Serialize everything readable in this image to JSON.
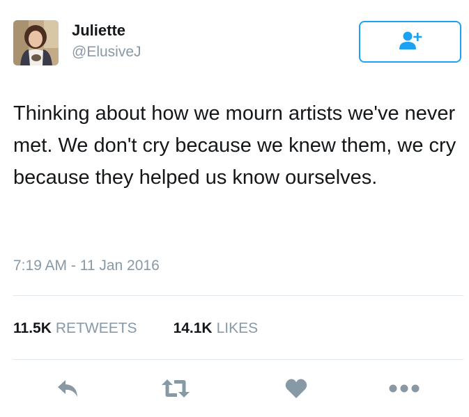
{
  "user": {
    "name": "Juliette",
    "handle": "@ElusiveJ"
  },
  "follow_button": {
    "icon": "add-user-icon"
  },
  "tweet": {
    "text": "Thinking about how we mourn artists we've never met. We don't cry because we knew them, we cry because they helped us know ourselves.",
    "timestamp": "7:19 AM - 11 Jan 2016"
  },
  "stats": {
    "retweets_count": "11.5K",
    "retweets_label": "RETWEETS",
    "likes_count": "14.1K",
    "likes_label": "LIKES"
  },
  "actions": [
    {
      "icon": "reply-icon"
    },
    {
      "icon": "retweet-icon"
    },
    {
      "icon": "heart-icon"
    },
    {
      "icon": "more-icon"
    }
  ],
  "colors": {
    "accent": "#1da1f2",
    "text": "#14171a",
    "secondary": "#8899a6",
    "icon": "#8899a6",
    "divider": "#e1e8ed"
  }
}
